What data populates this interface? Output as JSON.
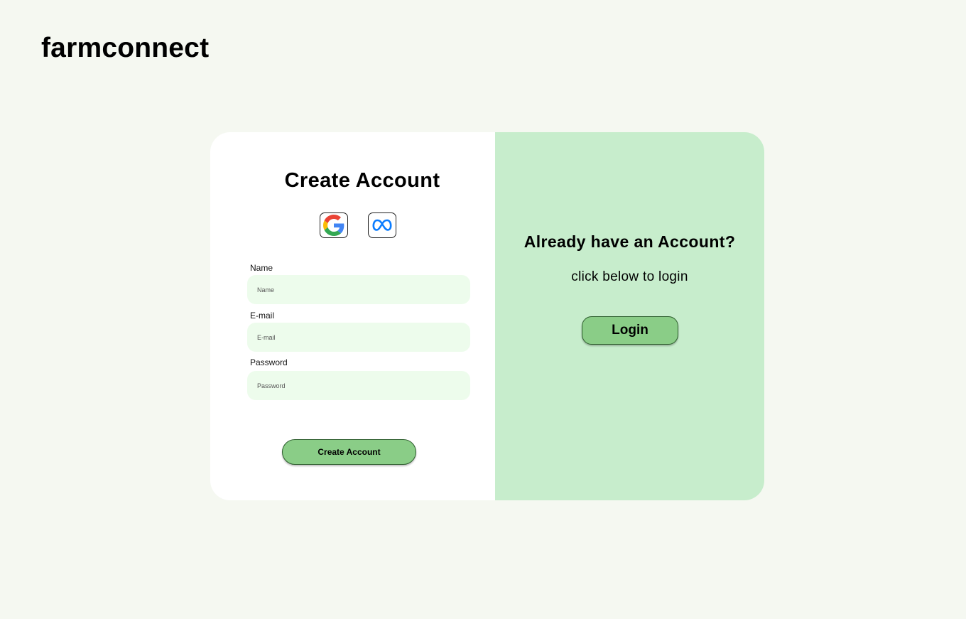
{
  "brand": {
    "name": "farmconnect"
  },
  "signup": {
    "title": "Create Account",
    "social": [
      {
        "icon": "google-icon"
      },
      {
        "icon": "meta-icon"
      }
    ],
    "fields": {
      "name": {
        "label": "Name",
        "placeholder": "Name",
        "value": ""
      },
      "email": {
        "label": "E-mail",
        "placeholder": "E-mail",
        "value": ""
      },
      "password": {
        "label": "Password",
        "placeholder": "Password",
        "value": ""
      }
    },
    "submit_label": "Create Account"
  },
  "login_panel": {
    "heading": "Already have an Account?",
    "subtext": "click below to login",
    "button_label": "Login"
  },
  "colors": {
    "page_background": "#f5f8f1",
    "panel_green": "#c7edcc",
    "input_background": "#edfcec",
    "button_green": "#8acd87",
    "meta_blue": "#0a7cff"
  }
}
